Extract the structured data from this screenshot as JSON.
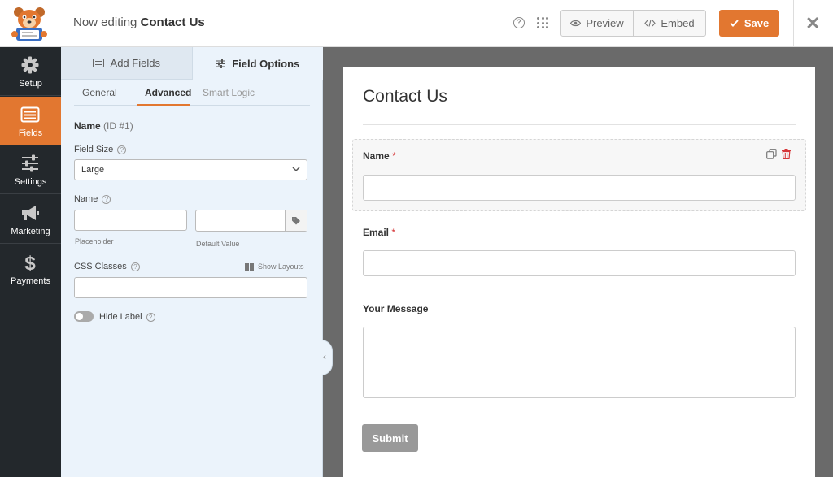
{
  "header": {
    "editing_prefix": "Now editing",
    "form_name": "Contact Us",
    "preview_label": "Preview",
    "embed_label": "Embed",
    "save_label": "Save"
  },
  "nav": {
    "items": [
      {
        "label": "Setup",
        "icon": "gear-icon"
      },
      {
        "label": "Fields",
        "icon": "fields-icon",
        "active": true
      },
      {
        "label": "Settings",
        "icon": "sliders-icon"
      },
      {
        "label": "Marketing",
        "icon": "megaphone-icon"
      },
      {
        "label": "Payments",
        "icon": "dollar-icon"
      }
    ]
  },
  "panel": {
    "tabs": [
      {
        "label": "Add Fields",
        "icon": "list-icon"
      },
      {
        "label": "Field Options",
        "icon": "sliders-icon",
        "active": true
      }
    ],
    "subtabs": [
      {
        "label": "General"
      },
      {
        "label": "Advanced",
        "active": true
      },
      {
        "label": "Smart Logic",
        "disabled": true
      }
    ],
    "field_name": "Name",
    "field_id": "(ID #1)",
    "field_size_label": "Field Size",
    "field_size_value": "Large",
    "name_label": "Name",
    "placeholder_sublabel": "Placeholder",
    "default_value_sublabel": "Default Value",
    "css_classes_label": "CSS Classes",
    "show_layouts_label": "Show Layouts",
    "hide_label_label": "Hide Label",
    "hide_label_on": false
  },
  "form": {
    "title": "Contact Us",
    "fields": [
      {
        "label": "Name",
        "required": "*"
      },
      {
        "label": "Email",
        "required": "*"
      },
      {
        "label": "Your Message"
      }
    ],
    "submit_label": "Submit"
  },
  "colors": {
    "accent": "#e27730",
    "sidebar": "#23282c",
    "panel": "#ebf3fb",
    "required": "#d63638"
  }
}
